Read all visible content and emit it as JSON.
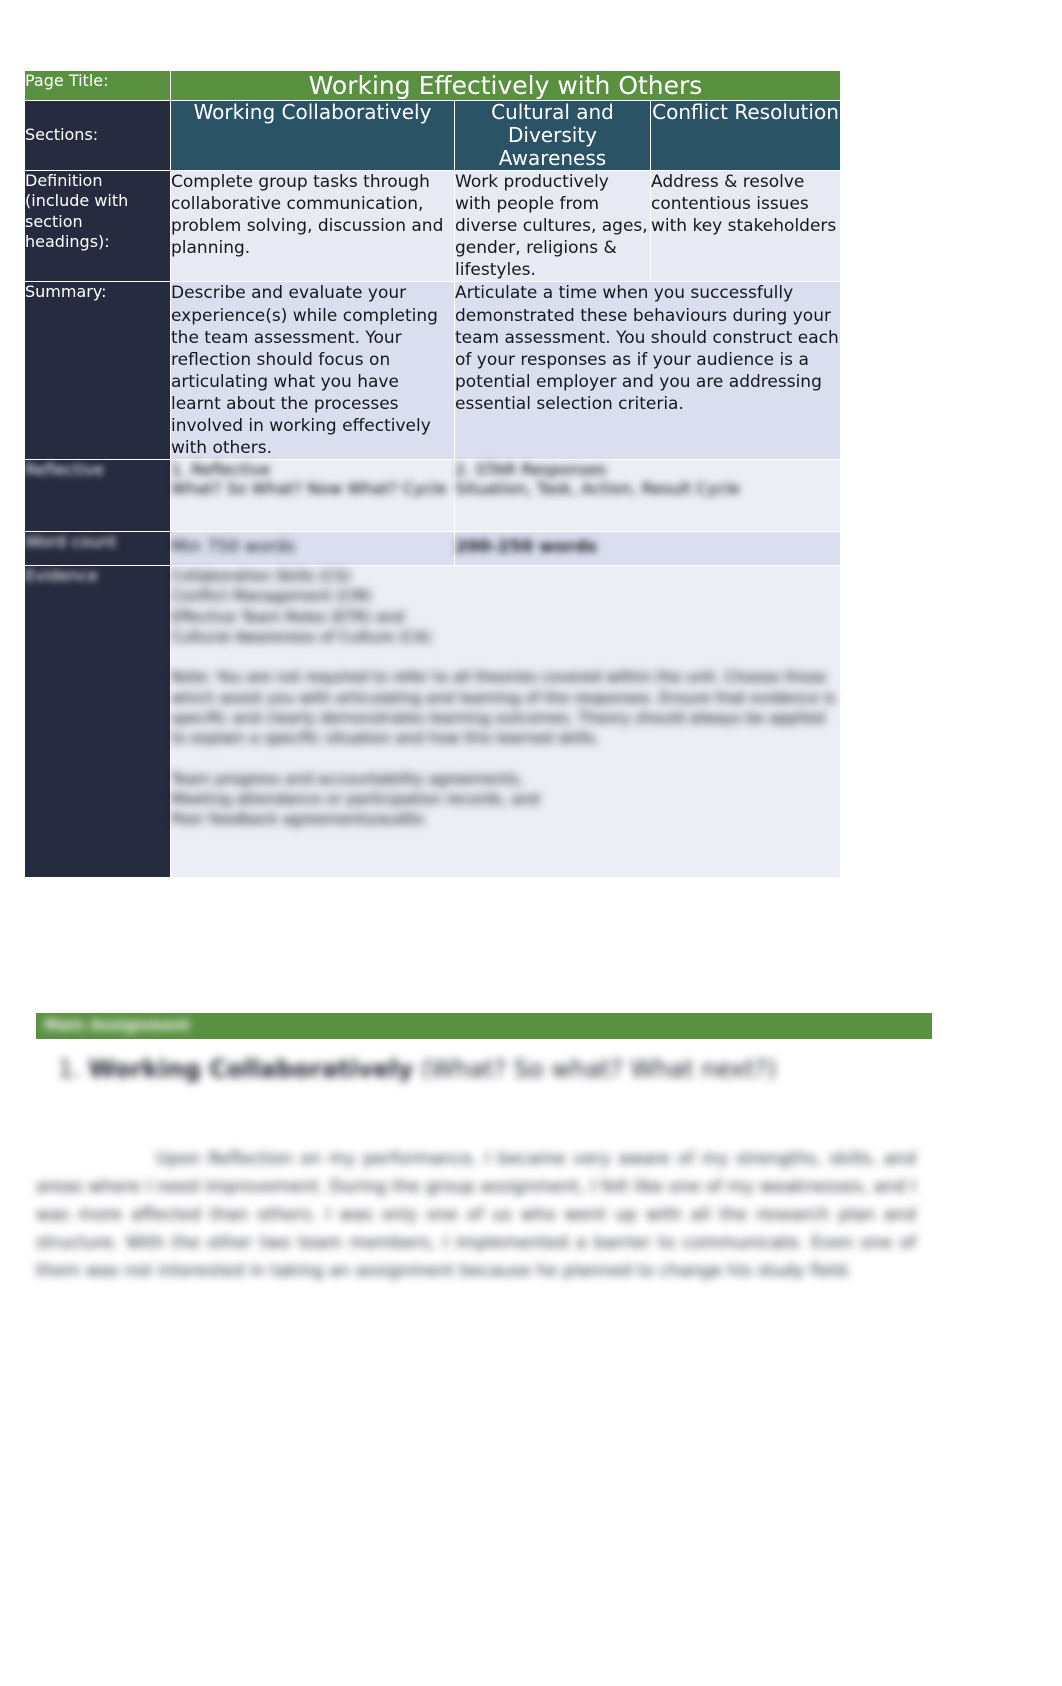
{
  "document": {
    "title_row": {
      "label": "Page Title:",
      "value": "Working Effectively with Others"
    },
    "sections_row": {
      "label": "Sections:",
      "columns": [
        "Working Collaboratively",
        "Cultural and Diversity Awareness",
        "Conflict Resolution"
      ]
    },
    "definition_row": {
      "label": "Definition (include with section headings):",
      "cells": [
        "Complete group tasks through collaborative communication, problem solving, discussion and planning.",
        "Work productively with people from diverse cultures, ages, gender, religions & lifestyles.",
        "Address & resolve contentious issues with key stakeholders"
      ]
    },
    "summary_row": {
      "label": "Summary:",
      "cells": [
        "Describe and evaluate your experience(s) while completing the team assessment. Your reflection should focus on articulating what you have learnt about the processes involved in working effectively with others.",
        "Articulate a time when you successfully demonstrated these behaviours during your team assessment.  You should construct each of your responses as if your audience is a potential employer and you are addressing essential selection criteria."
      ]
    },
    "obscured_rows": [
      {
        "label": "Reflective",
        "cells": [
          "1. Reflective\nWhat? So What? Now What? Cycle",
          "2. STAR Responses\nSituation, Task, Action, Result Cycle"
        ]
      },
      {
        "label": "Word count",
        "cells": [
          "Min 750 words",
          "200-250 words"
        ]
      },
      {
        "label": "Evidence",
        "cells": [
          "Collaboration Skills (CS)\nConflict Management (CM)\nEffective Team Roles (ETR) and\nCultural Awareness of Culture (CA)\n\nNote: You are not required to refer to all theories covered within the unit. Choose those which assist you with articulating and learning of the responses. Ensure that evidence is specific and clearly demonstrates learning outcomes. Theory should always be applied to explain a specific situation and how this learned skills.\n\nTeam progress and accountability agreements,\nMeeting attendance or participation records, and\nPeer feedback agreements/audits"
        ]
      }
    ],
    "heading_bar": {
      "text": "Main Assignment"
    },
    "section_heading": {
      "number": "1.",
      "bold_part": "Working Collaboratively",
      "rest_part": "(What? So what? What next?)"
    },
    "body_paragraph": "Upon Reflection on my performance, I became very aware of my strengths, skills, and areas where I need improvement. During the group assignment, I felt like one of my weaknesses, and I was more affected than others. I was only one of us who went up with all the research plan and structure. With the other two team members, I implemented a barrier to communicate. Even one of them was not interested in taking an assignment because he planned to change his study field.",
    "colors": {
      "green": "#5a9141",
      "teal": "#2b5366",
      "navy": "#262b40",
      "cell_lavender": "#e7e9f3",
      "cell_lavender_alt": "#dbdeee",
      "text_dark": "#16181d"
    }
  }
}
